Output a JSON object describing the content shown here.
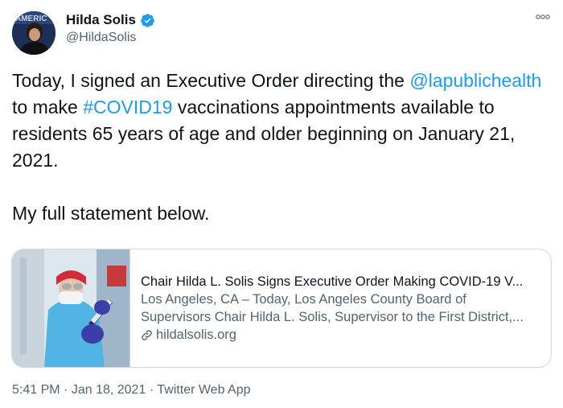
{
  "author": {
    "display_name": "Hilda Solis",
    "handle": "@HildaSolis",
    "verified": true
  },
  "tweet": {
    "line1_prefix": "Today, I signed an Executive Order directing the",
    "mention": "@lapublichealth",
    "mid": " to make ",
    "hashtag": "#COVID19",
    "suffix": " vaccinations appointments available to residents 65 years of age and older beginning on January 21, 2021.",
    "paragraph2": "My full statement below."
  },
  "card": {
    "title": "Chair Hilda L. Solis Signs Executive Order Making COVID-19 V...",
    "description": "Los Angeles, CA – Today, Los Angeles County Board of Supervisors Chair Hilda L. Solis, Supervisor to the First District,...",
    "domain": "hildalsolis.org"
  },
  "meta": {
    "time": "5:41 PM",
    "date": "Jan 18, 2021",
    "source": "Twitter Web App"
  },
  "icons": {
    "more": "more-options-icon",
    "verified": "verified-badge-icon",
    "link": "link-icon"
  },
  "colors": {
    "link_blue": "#1d9bf0",
    "secondary_text": "#536471",
    "border": "#cfd9de"
  }
}
